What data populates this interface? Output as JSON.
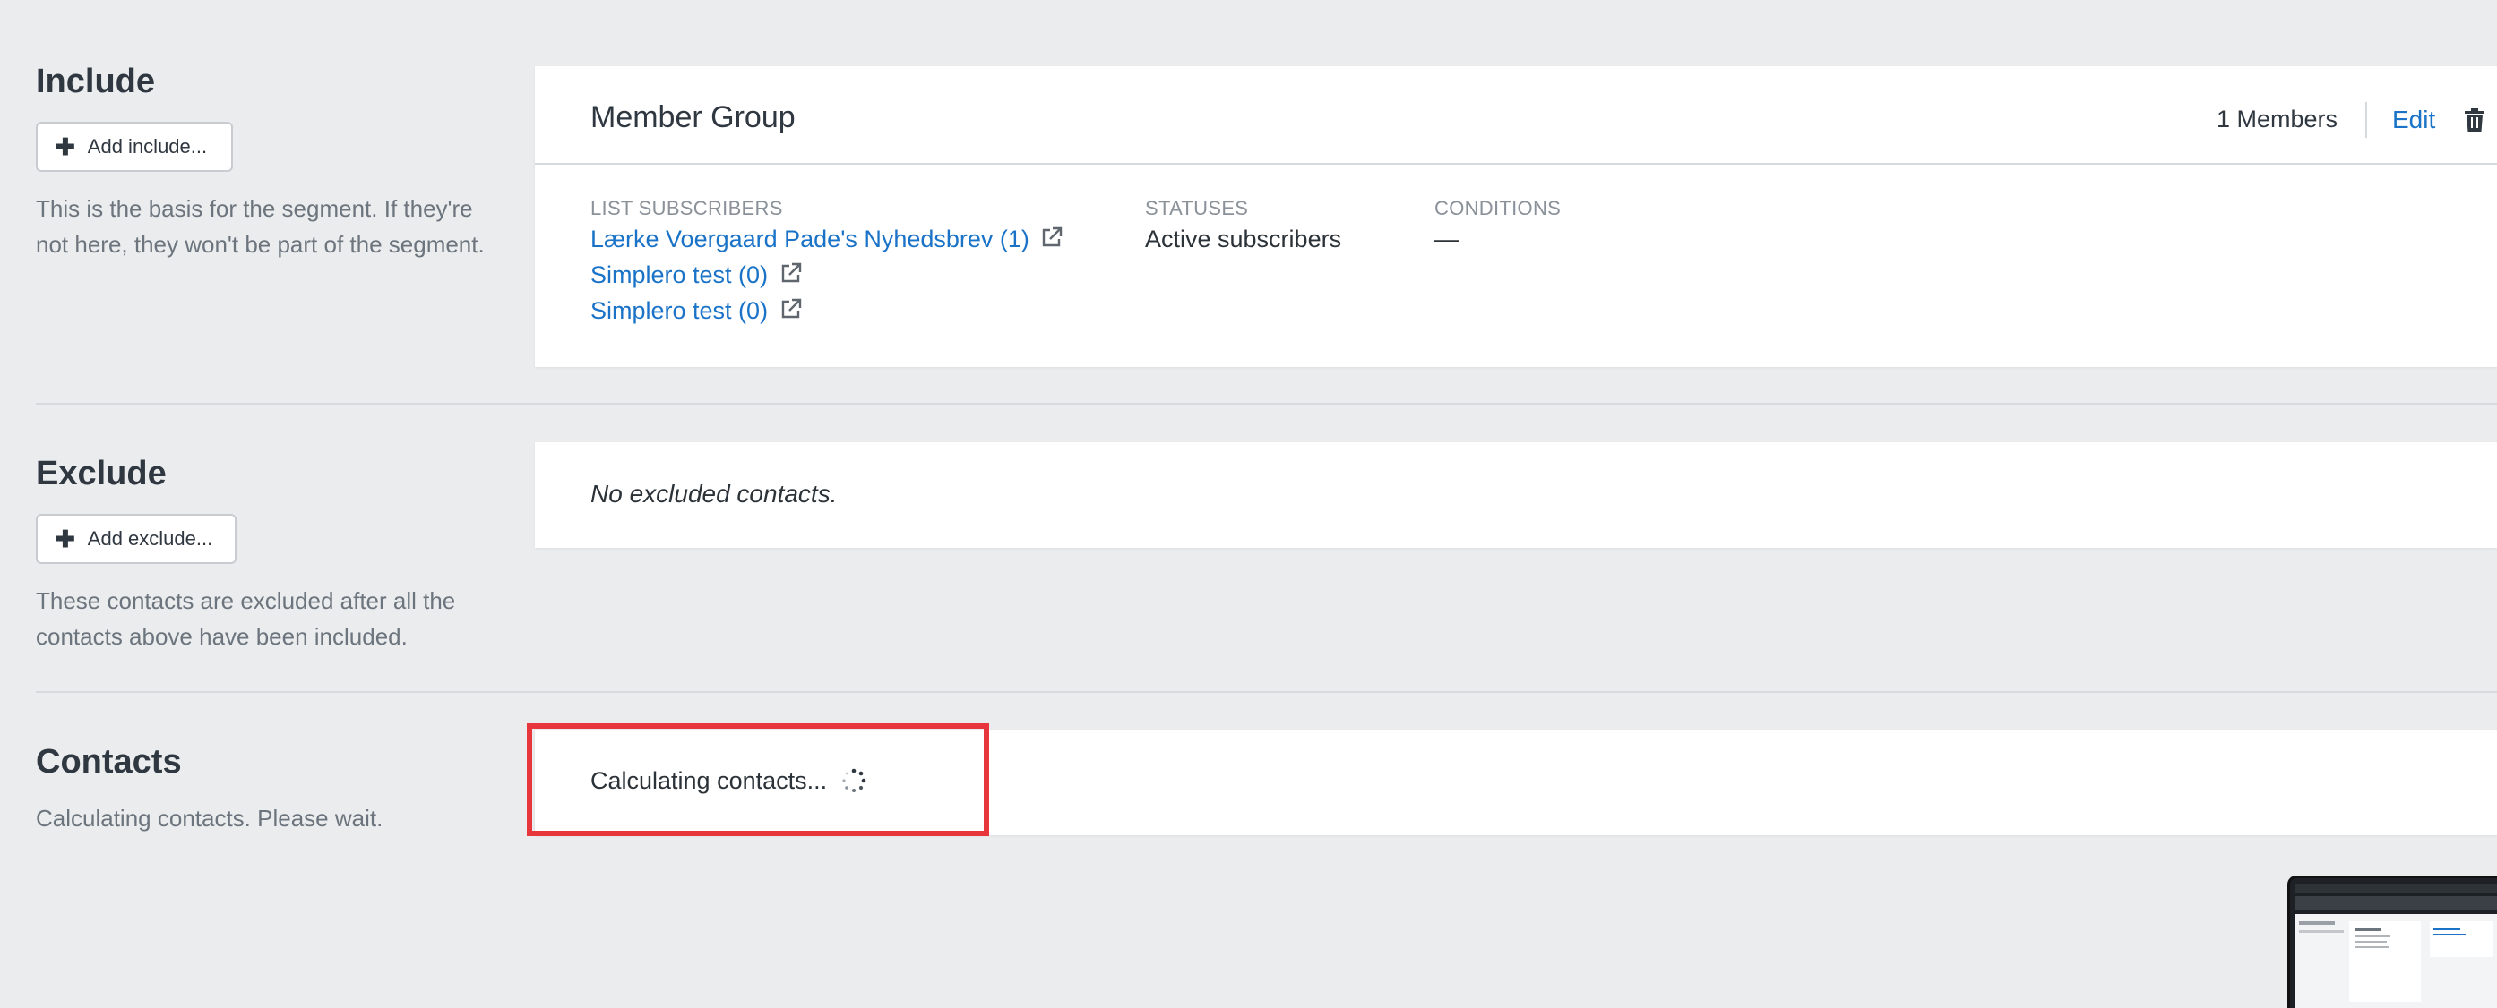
{
  "include": {
    "title": "Include",
    "button_label": "Add include...",
    "description": "This is the basis for the segment. If they're not here, they won't be part of the segment.",
    "card": {
      "group_title": "Member Group",
      "members": "1 Members",
      "edit_label": "Edit",
      "list_subscribers_label": "LIST SUBSCRIBERS",
      "lists": [
        "Lærke Voergaard Pade's Nyhedsbrev (1)",
        "Simplero test (0)",
        "Simplero test (0)"
      ],
      "statuses_label": "STATUSES",
      "statuses_value": "Active subscribers",
      "conditions_label": "CONDITIONS",
      "conditions_value": "—"
    }
  },
  "exclude": {
    "title": "Exclude",
    "button_label": "Add exclude...",
    "description": "These contacts are excluded after all the contacts above have been included.",
    "card_text": "No excluded contacts."
  },
  "contacts": {
    "title": "Contacts",
    "description": "Calculating contacts. Please wait.",
    "card_text": "Calculating contacts..."
  },
  "colors": {
    "link": "#1a73c7",
    "highlight": "#e8363d",
    "background": "#ebecee"
  }
}
